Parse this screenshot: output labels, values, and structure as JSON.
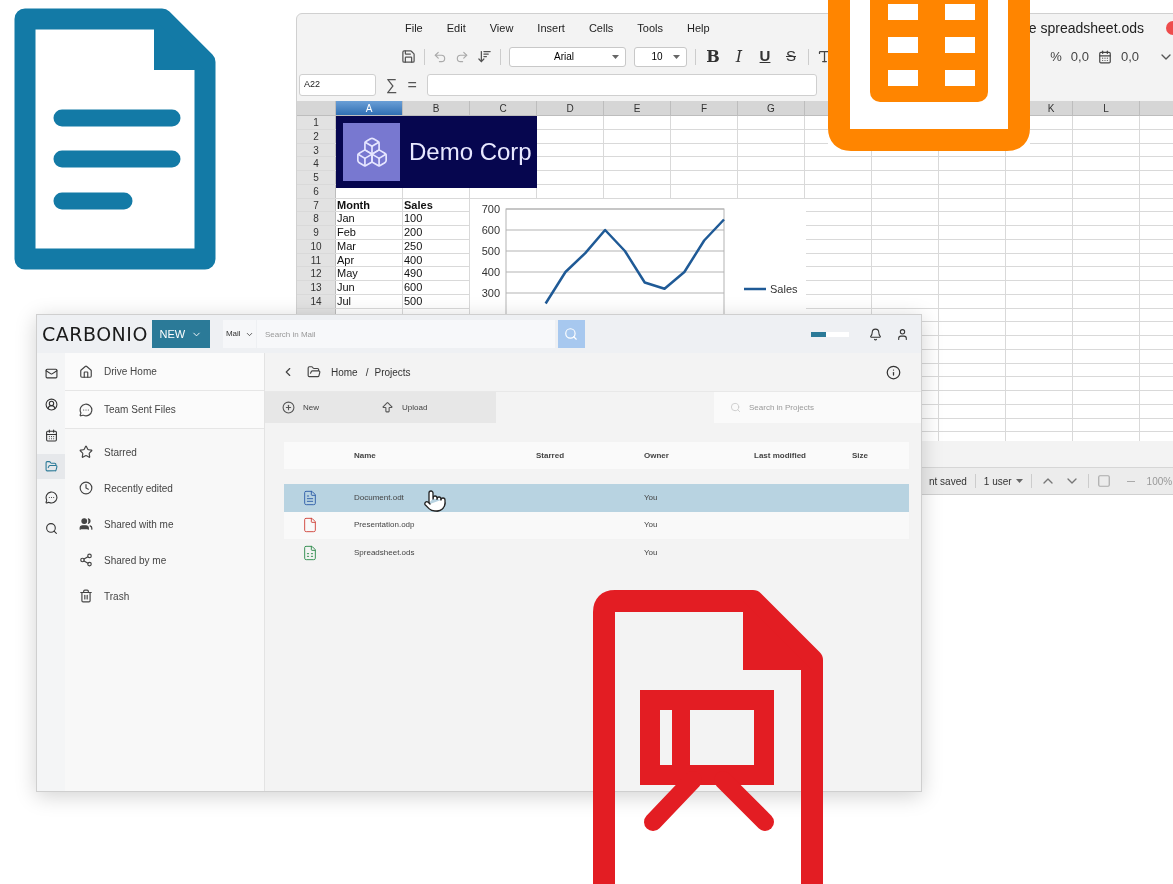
{
  "spreadsheet": {
    "title": "e spreadsheet.ods",
    "menu": [
      "File",
      "Edit",
      "View",
      "Insert",
      "Cells",
      "Tools",
      "Help"
    ],
    "font_name": "Arial",
    "font_size": "10",
    "format_buttons": [
      {
        "label": "B",
        "kind": "bold"
      },
      {
        "label": "I",
        "kind": "italic"
      },
      {
        "label": "U",
        "kind": "underline"
      },
      {
        "label": "S",
        "kind": "strike"
      }
    ],
    "number_buttons": [
      "%",
      "0,0",
      "0,0"
    ],
    "cell_reference": "A22",
    "sum_symbol": "∑",
    "equals_symbol": "=",
    "columns_left": [
      {
        "label": "A",
        "selected": true
      },
      {
        "label": "B",
        "selected": false
      },
      {
        "label": "C",
        "selected": false
      },
      {
        "label": "D",
        "selected": false
      },
      {
        "label": "E",
        "selected": false
      },
      {
        "label": "F",
        "selected": false
      },
      {
        "label": "G",
        "selected": false
      }
    ],
    "columns_right": [
      {
        "label": "K",
        "selected": false
      },
      {
        "label": "L",
        "selected": false
      }
    ],
    "rows": [
      {
        "number": "1"
      },
      {
        "number": "2"
      },
      {
        "number": "3"
      },
      {
        "number": "4"
      },
      {
        "number": "5"
      },
      {
        "number": "6"
      },
      {
        "number": "7",
        "kind": "header",
        "a": "Month",
        "b": "Sales"
      },
      {
        "number": "8",
        "kind": "data",
        "a": "Jan",
        "b": "100"
      },
      {
        "number": "9",
        "kind": "data",
        "a": "Feb",
        "b": "200"
      },
      {
        "number": "10",
        "kind": "data",
        "a": "Mar",
        "b": "250"
      },
      {
        "number": "11",
        "kind": "data",
        "a": "Apr",
        "b": "400"
      },
      {
        "number": "12",
        "kind": "data",
        "a": "May",
        "b": "490"
      },
      {
        "number": "13",
        "kind": "data",
        "a": "Jun",
        "b": "600"
      },
      {
        "number": "14",
        "kind": "data",
        "a": "Jul",
        "b": "500"
      }
    ],
    "banner": {
      "title": "Demo Corp"
    },
    "chart_data": {
      "type": "line",
      "ylim": [
        0,
        700
      ],
      "yticks": [
        300,
        400,
        500,
        600,
        700
      ],
      "grid": true,
      "series": [
        {
          "name": "Sales",
          "color": "#1f5a96",
          "values": [
            null,
            null,
            250,
            400,
            490,
            600,
            500,
            350,
            320,
            400,
            550,
            650
          ]
        }
      ]
    },
    "status": [
      "nt saved",
      "1 user",
      "100%"
    ]
  },
  "carbonio": {
    "logo": "CARBONIO",
    "new_button": "NEW",
    "search_scope": "Mail",
    "search_placeholder": "Search in Mail",
    "quota": {
      "level": 0.4
    },
    "rail": [
      {
        "kind": "mail",
        "selected": false
      },
      {
        "kind": "contacts",
        "selected": false
      },
      {
        "kind": "calendar",
        "selected": false
      },
      {
        "kind": "files",
        "selected": true
      },
      {
        "kind": "chats",
        "selected": false
      },
      {
        "kind": "search",
        "selected": false
      }
    ],
    "sidebar": [
      {
        "label": "Drive Home",
        "kind": "home",
        "selected": false
      },
      {
        "label": "Team Sent Files",
        "kind": "team",
        "selected": false
      },
      {
        "label": "Starred",
        "kind": "star",
        "selected": false
      },
      {
        "label": "Recently edited",
        "kind": "recent",
        "selected": false
      },
      {
        "label": "Shared with me",
        "kind": "shared_with",
        "selected": false
      },
      {
        "label": "Shared by me",
        "kind": "shared_by",
        "selected": false
      },
      {
        "label": "Trash",
        "kind": "trash",
        "selected": false
      }
    ],
    "breadcrumb": [
      "Home",
      "Projects"
    ],
    "breadcrumb_separator": "/",
    "actions": [
      {
        "label": "New",
        "kind": "new"
      },
      {
        "label": "Upload",
        "kind": "upload"
      }
    ],
    "files_search_placeholder": "Search in Projects",
    "table": {
      "columns": [
        "Name",
        "Starred",
        "Owner",
        "Last modified",
        "Size"
      ],
      "rows": [
        {
          "name": "Document.odt",
          "owner": "You",
          "kind": "document",
          "selected": true
        },
        {
          "name": "Presentation.odp",
          "owner": "You",
          "kind": "presentation",
          "selected": false
        },
        {
          "name": "Spreadsheet.ods",
          "owner": "You",
          "kind": "spreadsheet",
          "selected": false
        }
      ]
    }
  }
}
